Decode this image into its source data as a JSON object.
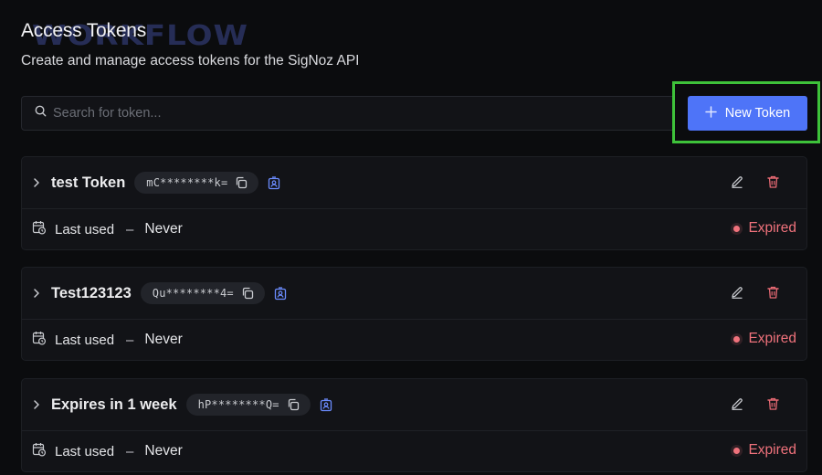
{
  "header": {
    "title": "Access Tokens",
    "watermark": "WORKFLOW",
    "subtitle": "Create and manage access tokens for the SigNoz API"
  },
  "search": {
    "placeholder": "Search for token...",
    "value": ""
  },
  "new_token": {
    "label": "New Token"
  },
  "tokens": [
    {
      "name": "test Token",
      "masked": "mC********k=",
      "last_used_label": "Last used",
      "dash": "–",
      "last_used_value": "Never",
      "status": "Expired"
    },
    {
      "name": "Test123123",
      "masked": "Qu********4=",
      "last_used_label": "Last used",
      "dash": "–",
      "last_used_value": "Never",
      "status": "Expired"
    },
    {
      "name": "Expires in 1 week",
      "masked": "hP********Q=",
      "last_used_label": "Last used",
      "dash": "–",
      "last_used_value": "Never",
      "status": "Expired"
    }
  ],
  "colors": {
    "accent": "#4e74f8",
    "expired": "#f0727c",
    "highlight": "#3ec23a"
  }
}
